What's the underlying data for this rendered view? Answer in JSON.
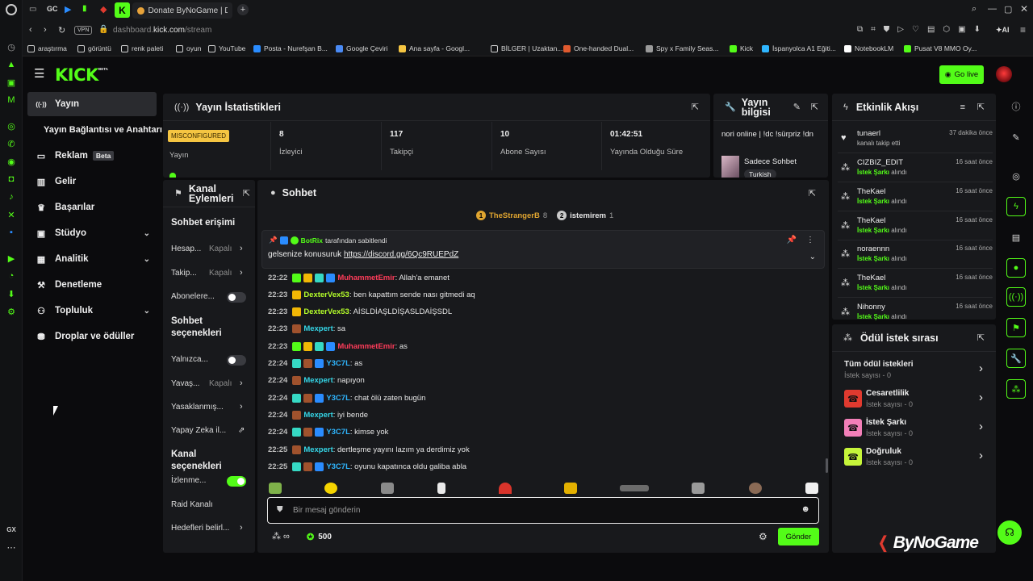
{
  "browser": {
    "tabs": [
      {
        "label": "Donate ByNoGame | Donati"
      }
    ],
    "vpn_label": "VPN",
    "url_host": "dashboard.",
    "url_domain": "kick.com",
    "url_path": "/stream",
    "ai_label": "AI",
    "gx_label": "GX",
    "bookmarks": [
      {
        "label": "araştırma",
        "icon": "folder-icon"
      },
      {
        "label": "görüntü",
        "icon": "folder-icon"
      },
      {
        "label": "renk paleti",
        "icon": "folder-icon"
      },
      {
        "label": "oyun",
        "icon": "folder-icon"
      },
      {
        "label": "YouTube",
        "icon": "page-icon"
      },
      {
        "label": "Posta - Nurefşan B...",
        "icon": "outlook-icon"
      },
      {
        "label": "Google Çeviri",
        "icon": "translate-icon"
      },
      {
        "label": "Ana sayfa - Googl...",
        "icon": "drive-icon"
      },
      {
        "label": "BİLGER | Uzaktan...",
        "icon": "page-icon"
      },
      {
        "label": "One-handed Dual...",
        "icon": "pdf-icon"
      },
      {
        "label": "Spy x Family Seas...",
        "icon": "star-icon"
      },
      {
        "label": "Kick",
        "icon": "kick-icon"
      },
      {
        "label": "İspanyolca A1 Eğiti...",
        "icon": "edge-icon"
      },
      {
        "label": "NotebookLM",
        "icon": "notebook-icon"
      },
      {
        "label": "Pusat V8 MMO Oy...",
        "icon": "game-icon"
      }
    ]
  },
  "header": {
    "logo": "KICK",
    "logo_beta": "BETA",
    "go_live_label": "Go live"
  },
  "sidebar": {
    "items": [
      {
        "label": "Yayın",
        "icon": "broadcast-icon",
        "active": true
      },
      {
        "label": "Yayın Bağlantısı ve Anahtarı",
        "icon": ""
      },
      {
        "label": "Reklam",
        "icon": "monitor-icon",
        "badge": "Beta"
      },
      {
        "label": "Gelir",
        "icon": "chart-icon"
      },
      {
        "label": "Başarılar",
        "icon": "trophy-icon"
      },
      {
        "label": "Stüdyo",
        "icon": "studio-icon",
        "expandable": true
      },
      {
        "label": "Analitik",
        "icon": "analytics-icon",
        "expandable": true
      },
      {
        "label": "Denetleme",
        "icon": "hammer-icon"
      },
      {
        "label": "Topluluk",
        "icon": "people-icon",
        "expandable": true
      },
      {
        "label": "Droplar ve ödüller",
        "icon": "drops-icon"
      }
    ]
  },
  "stats_panel": {
    "title": "Yayın İstatistikleri",
    "status_badge": "MISCONFIGURED",
    "status_label": "Yayın",
    "stats": [
      {
        "value": "8",
        "label": "İzleyici"
      },
      {
        "value": "117",
        "label": "Takipçi"
      },
      {
        "value": "10",
        "label": "Abone Sayısı"
      },
      {
        "value": "01:42:51",
        "label": "Yayında Olduğu Süre"
      }
    ]
  },
  "stream_info": {
    "title": "Yayın bilgisi",
    "stream_title": "nori online | !dc !sürpriz !dn",
    "category": "Sadece Sohbet",
    "tag": "Turkish"
  },
  "channel_actions": {
    "title": "Kanal Eylemleri",
    "sections": [
      {
        "heading": "Sohbet erişimi",
        "rows": [
          {
            "label": "Hesap...",
            "value": "Kapalı",
            "control": "chevron"
          },
          {
            "label": "Takip...",
            "value": "Kapalı",
            "control": "chevron"
          },
          {
            "label": "Abonelere...",
            "value": "",
            "control": "toggle-off"
          }
        ]
      },
      {
        "heading": "Sohbet seçenekleri",
        "rows": [
          {
            "label": "Yalnızca...",
            "value": "",
            "control": "toggle-off"
          },
          {
            "label": "Yavaş...",
            "value": "Kapalı",
            "control": "chevron"
          },
          {
            "label": "Yasaklanmış...",
            "value": "",
            "control": "chevron"
          },
          {
            "label": "Yapay Zeka il...",
            "value": "",
            "control": "external"
          }
        ]
      },
      {
        "heading": "Kanal seçenekleri",
        "rows": [
          {
            "label": "İzlenme...",
            "value": "",
            "control": "toggle-on"
          },
          {
            "label": "Raid Kanalı",
            "value": "",
            "control": "none"
          },
          {
            "label": "Hedefleri belirl...",
            "value": "",
            "control": "chevron"
          }
        ]
      }
    ]
  },
  "chat": {
    "title": "Sohbet",
    "top_users": [
      {
        "rank": "1",
        "name": "TheStrangerB",
        "count": "8"
      },
      {
        "rank": "2",
        "name": "istemirem",
        "count": "1"
      }
    ],
    "pinned": {
      "by_user": "BotRix",
      "by_suffix": "tarafından sabitlendi",
      "text": "gelsenize konusuruk ",
      "link": "https://discord.gg/6Qc9RUEPdZ"
    },
    "messages": [
      {
        "time": "22:22",
        "user": "MuhammetEmir",
        "color": "#ff3c5a",
        "text": ": Allah'a emanet",
        "badges": [
          "#53fc18",
          "#f2b705",
          "#36d9c4",
          "#2a8cff"
        ]
      },
      {
        "time": "22:23",
        "user": "DexterVex53",
        "color": "#b5ff2a",
        "text": ": ben kapattım sende nası gitmedi aq",
        "badges": [
          "#f2b705"
        ]
      },
      {
        "time": "22:23",
        "user": "DexterVex53",
        "color": "#b5ff2a",
        "text": ": AİSLDİAŞLDİŞASLDAİŞSDL",
        "badges": [
          "#f2b705"
        ]
      },
      {
        "time": "22:23",
        "user": "Mexpert",
        "color": "#35d7e8",
        "text": ": sa",
        "badges": [
          "#a0522d"
        ]
      },
      {
        "time": "22:23",
        "user": "MuhammetEmir",
        "color": "#ff3c5a",
        "text": ": as",
        "badges": [
          "#53fc18",
          "#f2b705",
          "#36d9c4",
          "#2a8cff"
        ]
      },
      {
        "time": "22:24",
        "user": "Y3C7L",
        "color": "#2fb6ff",
        "text": ": as",
        "badges": [
          "#36d9c4",
          "#a0522d",
          "#2a8cff"
        ]
      },
      {
        "time": "22:24",
        "user": "Mexpert",
        "color": "#35d7e8",
        "text": ": napıyon",
        "badges": [
          "#a0522d"
        ]
      },
      {
        "time": "22:24",
        "user": "Y3C7L",
        "color": "#2fb6ff",
        "text": ": chat ölü zaten bugün",
        "badges": [
          "#36d9c4",
          "#a0522d",
          "#2a8cff"
        ]
      },
      {
        "time": "22:24",
        "user": "Mexpert",
        "color": "#35d7e8",
        "text": ": iyi bende",
        "badges": [
          "#a0522d"
        ]
      },
      {
        "time": "22:24",
        "user": "Y3C7L",
        "color": "#2fb6ff",
        "text": ": kimse yok",
        "badges": [
          "#36d9c4",
          "#a0522d",
          "#2a8cff"
        ]
      },
      {
        "time": "22:25",
        "user": "Mexpert",
        "color": "#35d7e8",
        "text": ": dertleşme yayını lazım ya derdimiz yok",
        "badges": [
          "#a0522d"
        ]
      },
      {
        "time": "22:25",
        "user": "Y3C7L",
        "color": "#2fb6ff",
        "text": ": oyunu kapatınca oldu galiba abla",
        "badges": [
          "#36d9c4",
          "#a0522d",
          "#2a8cff"
        ]
      }
    ],
    "input_placeholder": "Bir mesaj gönderin",
    "points_symbol": "∞",
    "coins": "500",
    "send_label": "Gönder"
  },
  "activity": {
    "title": "Etkinlik Akışı",
    "items": [
      {
        "name": "tunaerl",
        "desc": "kanalı takip etti",
        "time": "37 dakika önce",
        "icon": "heart-icon"
      },
      {
        "name": "CIZBIZ_EDIT",
        "desc_highlight": "İstek Şarkı",
        "desc": " alındı",
        "time": "16 saat önce",
        "icon": "reward-icon"
      },
      {
        "name": "TheKael",
        "desc_highlight": "İstek Şarkı",
        "desc": " alındı",
        "time": "16 saat önce",
        "icon": "reward-icon"
      },
      {
        "name": "TheKael",
        "desc_highlight": "İstek Şarkı",
        "desc": " alındı",
        "time": "16 saat önce",
        "icon": "reward-icon"
      },
      {
        "name": "noraennn",
        "desc_highlight": "İstek Şarkı",
        "desc": " alındı",
        "time": "16 saat önce",
        "icon": "reward-icon"
      },
      {
        "name": "TheKael",
        "desc_highlight": "İstek Şarkı",
        "desc": " alındı",
        "time": "16 saat önce",
        "icon": "reward-icon"
      },
      {
        "name": "Nihonny",
        "desc_highlight": "İstek Şarkı",
        "desc": " alındı",
        "time": "16 saat önce",
        "icon": "reward-icon"
      }
    ]
  },
  "rewards": {
    "title": "Ödül istek sırası",
    "items": [
      {
        "name": "Tüm ödül istekleri",
        "count": "İstek sayısı - 0",
        "color": ""
      },
      {
        "name": "Cesaretlilik",
        "count": "İstek sayısı - 0",
        "color": "#e03a2f"
      },
      {
        "name": "İstek Şarkı",
        "count": "İstek sayısı - 0",
        "color": "#f27fb8"
      },
      {
        "name": "Doğruluk",
        "count": "İstek sayısı - 0",
        "color": "#c6f53a"
      }
    ]
  },
  "watermark": "ByNoGame"
}
